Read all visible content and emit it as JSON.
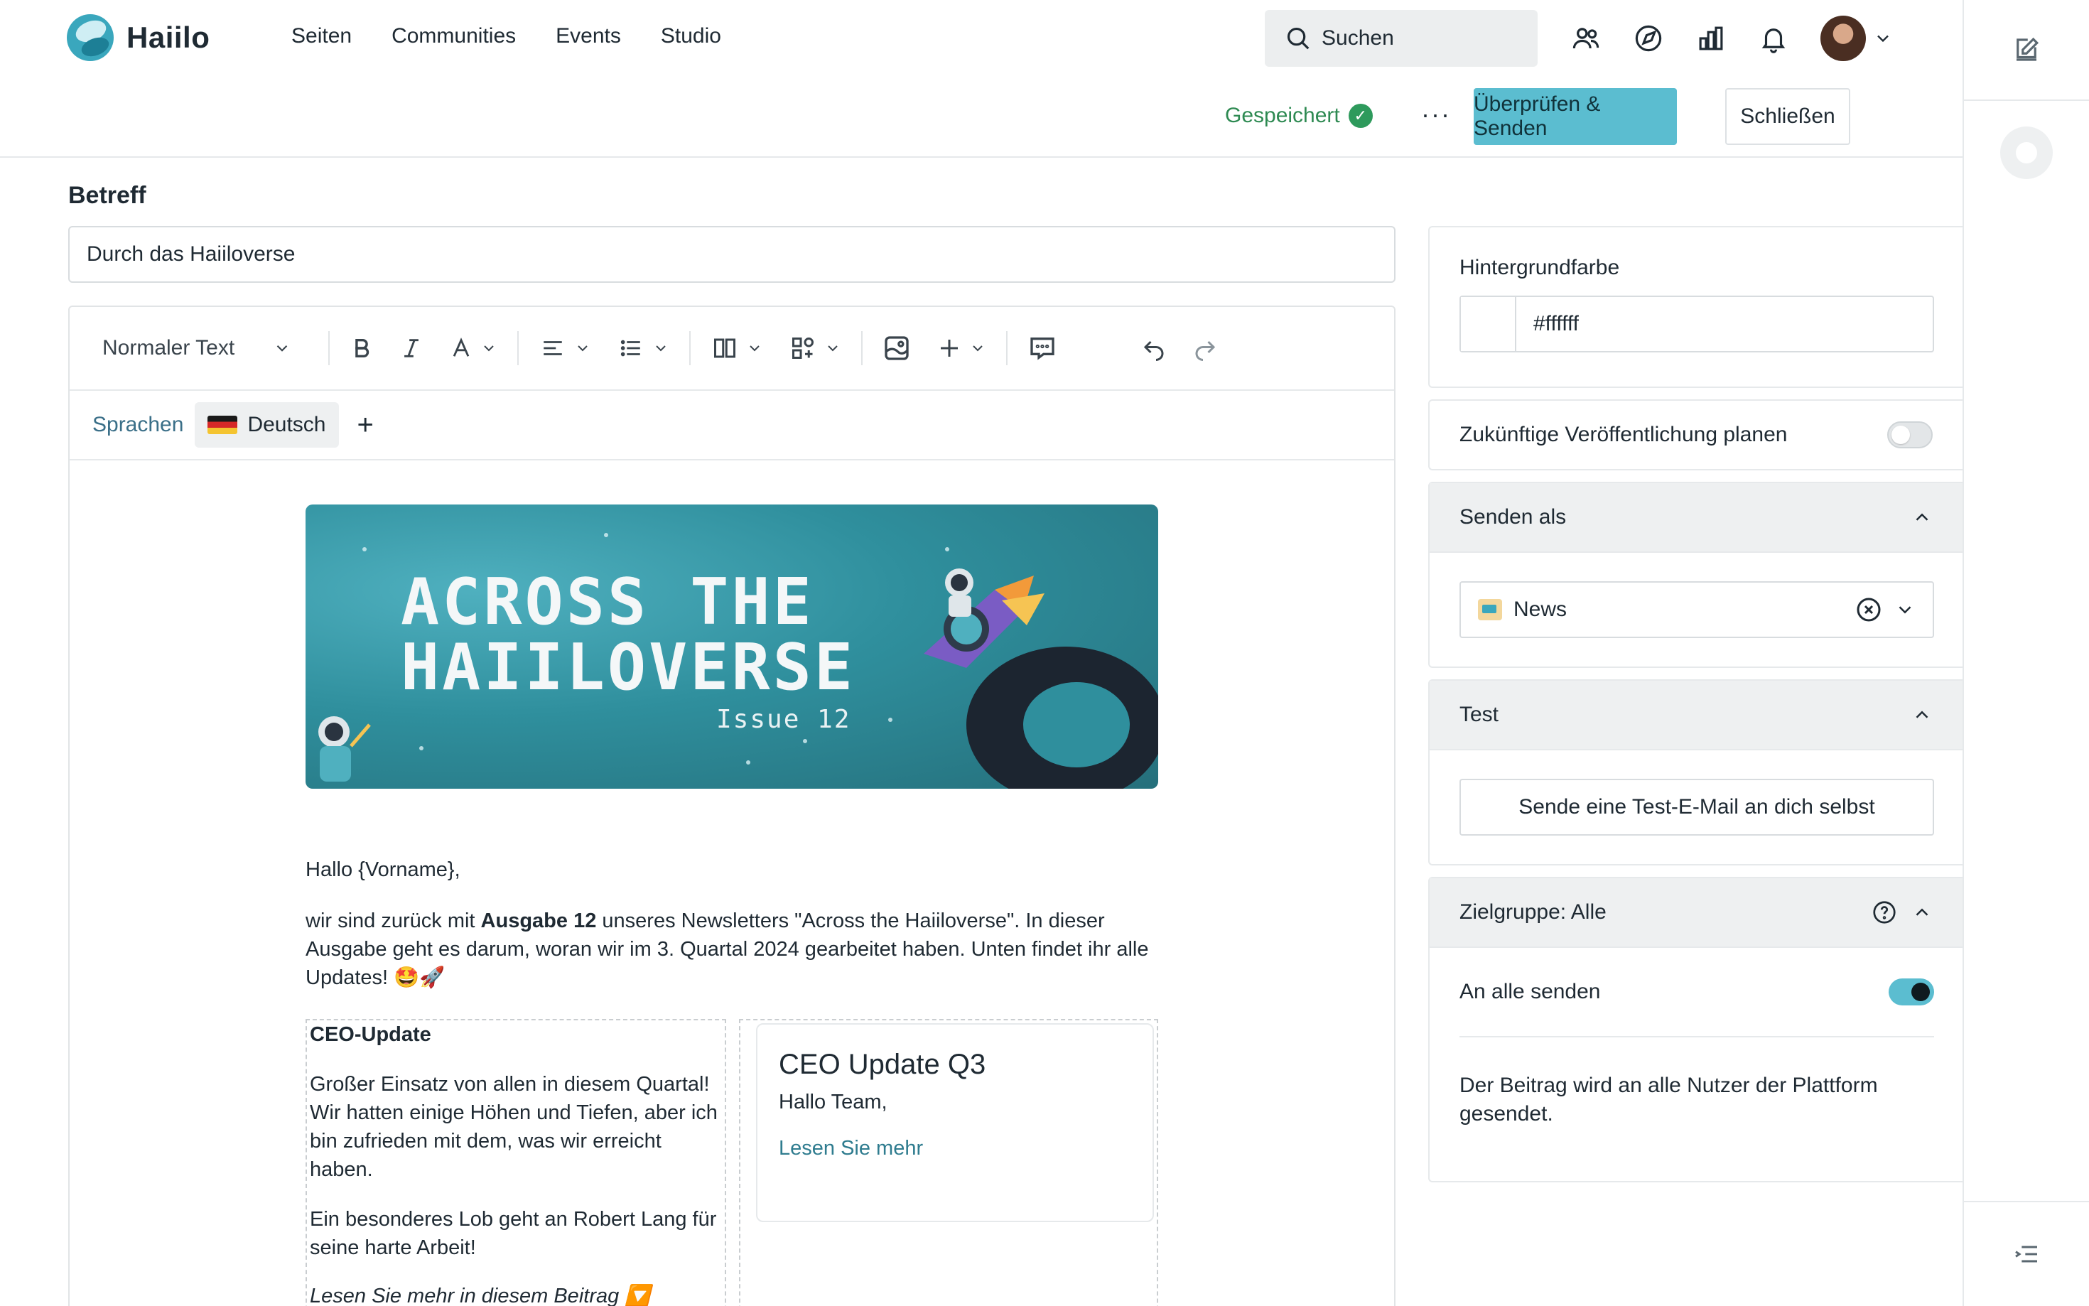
{
  "brand": {
    "name": "Haiilo"
  },
  "nav": {
    "items": [
      "Seiten",
      "Communities",
      "Events",
      "Studio"
    ]
  },
  "search": {
    "placeholder": "Suchen"
  },
  "header_icons": [
    "people-icon",
    "compass-icon",
    "chart-icon",
    "bell-icon"
  ],
  "actions": {
    "saved_label": "Gespeichert",
    "more_label": "···",
    "primary_label": "Überprüfen & Senden",
    "close_label": "Schließen"
  },
  "subject": {
    "label": "Betreff",
    "value": "Durch das Haiiloverse"
  },
  "toolbar": {
    "text_style": "Normaler Text"
  },
  "languages": {
    "label": "Sprachen",
    "current": "Deutsch",
    "add": "+"
  },
  "banner": {
    "title_line1": "ACROSS THE",
    "title_line2": "HAIILOVERSE",
    "issue": "Issue 12"
  },
  "content": {
    "greeting": "Hallo {Vorname},",
    "intro_pre": "wir sind zurück mit ",
    "intro_bold": "Ausgabe 12",
    "intro_post": " unseres Newsletters \"Across the Haiiloverse\". In dieser Ausgabe geht es darum, woran wir im 3. Quartal 2024 gearbeitet haben. Unten findet ihr alle Updates! 🤩🚀",
    "col1_title": "CEO-Update",
    "col1_p1": "Großer Einsatz von allen in diesem Quartal! Wir hatten einige Höhen und Tiefen, aber ich bin zufrieden mit dem, was wir erreicht haben.",
    "col1_p2": "Ein besonderes Lob geht an Robert Lang für seine harte Arbeit!",
    "col1_link": "Lesen Sie mehr in diesem Beitrag 🔽",
    "card_title": "CEO Update Q3",
    "card_body": "Hallo Team,",
    "card_link": "Lesen Sie mehr"
  },
  "sidebar": {
    "bg_label": "Hintergrundfarbe",
    "bg_value": "#ffffff",
    "schedule_label": "Zukünftige Veröffentlichung planen",
    "schedule_enabled": false,
    "send_as_title": "Senden als",
    "send_as_value": "News",
    "test_title": "Test",
    "test_button": "Sende eine Test-E-Mail an dich selbst",
    "audience_title": "Zielgruppe: Alle",
    "send_all_label": "An alle senden",
    "send_all_enabled": true,
    "audience_desc": "Der Beitrag wird an alle Nutzer der Plattform gesendet."
  },
  "colors": {
    "accent": "#5bbdd0",
    "saved_green": "#2e8a52",
    "link": "#2f7c8f",
    "panel_head_bg": "#eef0f1"
  }
}
